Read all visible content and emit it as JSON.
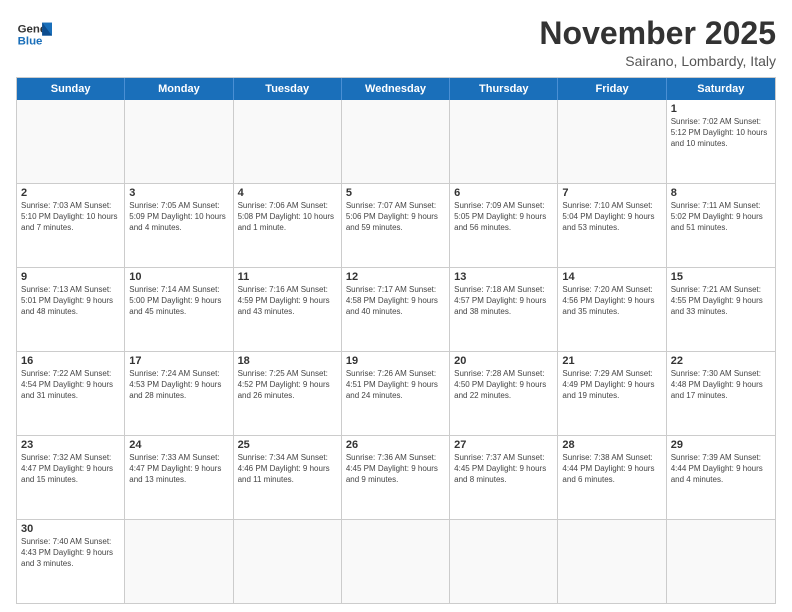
{
  "header": {
    "logo_general": "General",
    "logo_blue": "Blue",
    "title": "November 2025",
    "subtitle": "Sairano, Lombardy, Italy"
  },
  "days": [
    "Sunday",
    "Monday",
    "Tuesday",
    "Wednesday",
    "Thursday",
    "Friday",
    "Saturday"
  ],
  "rows": [
    [
      {
        "date": "",
        "empty": true
      },
      {
        "date": "",
        "empty": true
      },
      {
        "date": "",
        "empty": true
      },
      {
        "date": "",
        "empty": true
      },
      {
        "date": "",
        "empty": true
      },
      {
        "date": "",
        "empty": true
      },
      {
        "date": "1",
        "info": "Sunrise: 7:02 AM\nSunset: 5:12 PM\nDaylight: 10 hours\nand 10 minutes."
      }
    ],
    [
      {
        "date": "2",
        "info": "Sunrise: 7:03 AM\nSunset: 5:10 PM\nDaylight: 10 hours\nand 7 minutes."
      },
      {
        "date": "3",
        "info": "Sunrise: 7:05 AM\nSunset: 5:09 PM\nDaylight: 10 hours\nand 4 minutes."
      },
      {
        "date": "4",
        "info": "Sunrise: 7:06 AM\nSunset: 5:08 PM\nDaylight: 10 hours\nand 1 minute."
      },
      {
        "date": "5",
        "info": "Sunrise: 7:07 AM\nSunset: 5:06 PM\nDaylight: 9 hours\nand 59 minutes."
      },
      {
        "date": "6",
        "info": "Sunrise: 7:09 AM\nSunset: 5:05 PM\nDaylight: 9 hours\nand 56 minutes."
      },
      {
        "date": "7",
        "info": "Sunrise: 7:10 AM\nSunset: 5:04 PM\nDaylight: 9 hours\nand 53 minutes."
      },
      {
        "date": "8",
        "info": "Sunrise: 7:11 AM\nSunset: 5:02 PM\nDaylight: 9 hours\nand 51 minutes."
      }
    ],
    [
      {
        "date": "9",
        "info": "Sunrise: 7:13 AM\nSunset: 5:01 PM\nDaylight: 9 hours\nand 48 minutes."
      },
      {
        "date": "10",
        "info": "Sunrise: 7:14 AM\nSunset: 5:00 PM\nDaylight: 9 hours\nand 45 minutes."
      },
      {
        "date": "11",
        "info": "Sunrise: 7:16 AM\nSunset: 4:59 PM\nDaylight: 9 hours\nand 43 minutes."
      },
      {
        "date": "12",
        "info": "Sunrise: 7:17 AM\nSunset: 4:58 PM\nDaylight: 9 hours\nand 40 minutes."
      },
      {
        "date": "13",
        "info": "Sunrise: 7:18 AM\nSunset: 4:57 PM\nDaylight: 9 hours\nand 38 minutes."
      },
      {
        "date": "14",
        "info": "Sunrise: 7:20 AM\nSunset: 4:56 PM\nDaylight: 9 hours\nand 35 minutes."
      },
      {
        "date": "15",
        "info": "Sunrise: 7:21 AM\nSunset: 4:55 PM\nDaylight: 9 hours\nand 33 minutes."
      }
    ],
    [
      {
        "date": "16",
        "info": "Sunrise: 7:22 AM\nSunset: 4:54 PM\nDaylight: 9 hours\nand 31 minutes."
      },
      {
        "date": "17",
        "info": "Sunrise: 7:24 AM\nSunset: 4:53 PM\nDaylight: 9 hours\nand 28 minutes."
      },
      {
        "date": "18",
        "info": "Sunrise: 7:25 AM\nSunset: 4:52 PM\nDaylight: 9 hours\nand 26 minutes."
      },
      {
        "date": "19",
        "info": "Sunrise: 7:26 AM\nSunset: 4:51 PM\nDaylight: 9 hours\nand 24 minutes."
      },
      {
        "date": "20",
        "info": "Sunrise: 7:28 AM\nSunset: 4:50 PM\nDaylight: 9 hours\nand 22 minutes."
      },
      {
        "date": "21",
        "info": "Sunrise: 7:29 AM\nSunset: 4:49 PM\nDaylight: 9 hours\nand 19 minutes."
      },
      {
        "date": "22",
        "info": "Sunrise: 7:30 AM\nSunset: 4:48 PM\nDaylight: 9 hours\nand 17 minutes."
      }
    ],
    [
      {
        "date": "23",
        "info": "Sunrise: 7:32 AM\nSunset: 4:47 PM\nDaylight: 9 hours\nand 15 minutes."
      },
      {
        "date": "24",
        "info": "Sunrise: 7:33 AM\nSunset: 4:47 PM\nDaylight: 9 hours\nand 13 minutes."
      },
      {
        "date": "25",
        "info": "Sunrise: 7:34 AM\nSunset: 4:46 PM\nDaylight: 9 hours\nand 11 minutes."
      },
      {
        "date": "26",
        "info": "Sunrise: 7:36 AM\nSunset: 4:45 PM\nDaylight: 9 hours\nand 9 minutes."
      },
      {
        "date": "27",
        "info": "Sunrise: 7:37 AM\nSunset: 4:45 PM\nDaylight: 9 hours\nand 8 minutes."
      },
      {
        "date": "28",
        "info": "Sunrise: 7:38 AM\nSunset: 4:44 PM\nDaylight: 9 hours\nand 6 minutes."
      },
      {
        "date": "29",
        "info": "Sunrise: 7:39 AM\nSunset: 4:44 PM\nDaylight: 9 hours\nand 4 minutes."
      }
    ],
    [
      {
        "date": "30",
        "info": "Sunrise: 7:40 AM\nSunset: 4:43 PM\nDaylight: 9 hours\nand 3 minutes."
      },
      {
        "date": "",
        "empty": true
      },
      {
        "date": "",
        "empty": true
      },
      {
        "date": "",
        "empty": true
      },
      {
        "date": "",
        "empty": true
      },
      {
        "date": "",
        "empty": true
      },
      {
        "date": "",
        "empty": true
      }
    ]
  ]
}
